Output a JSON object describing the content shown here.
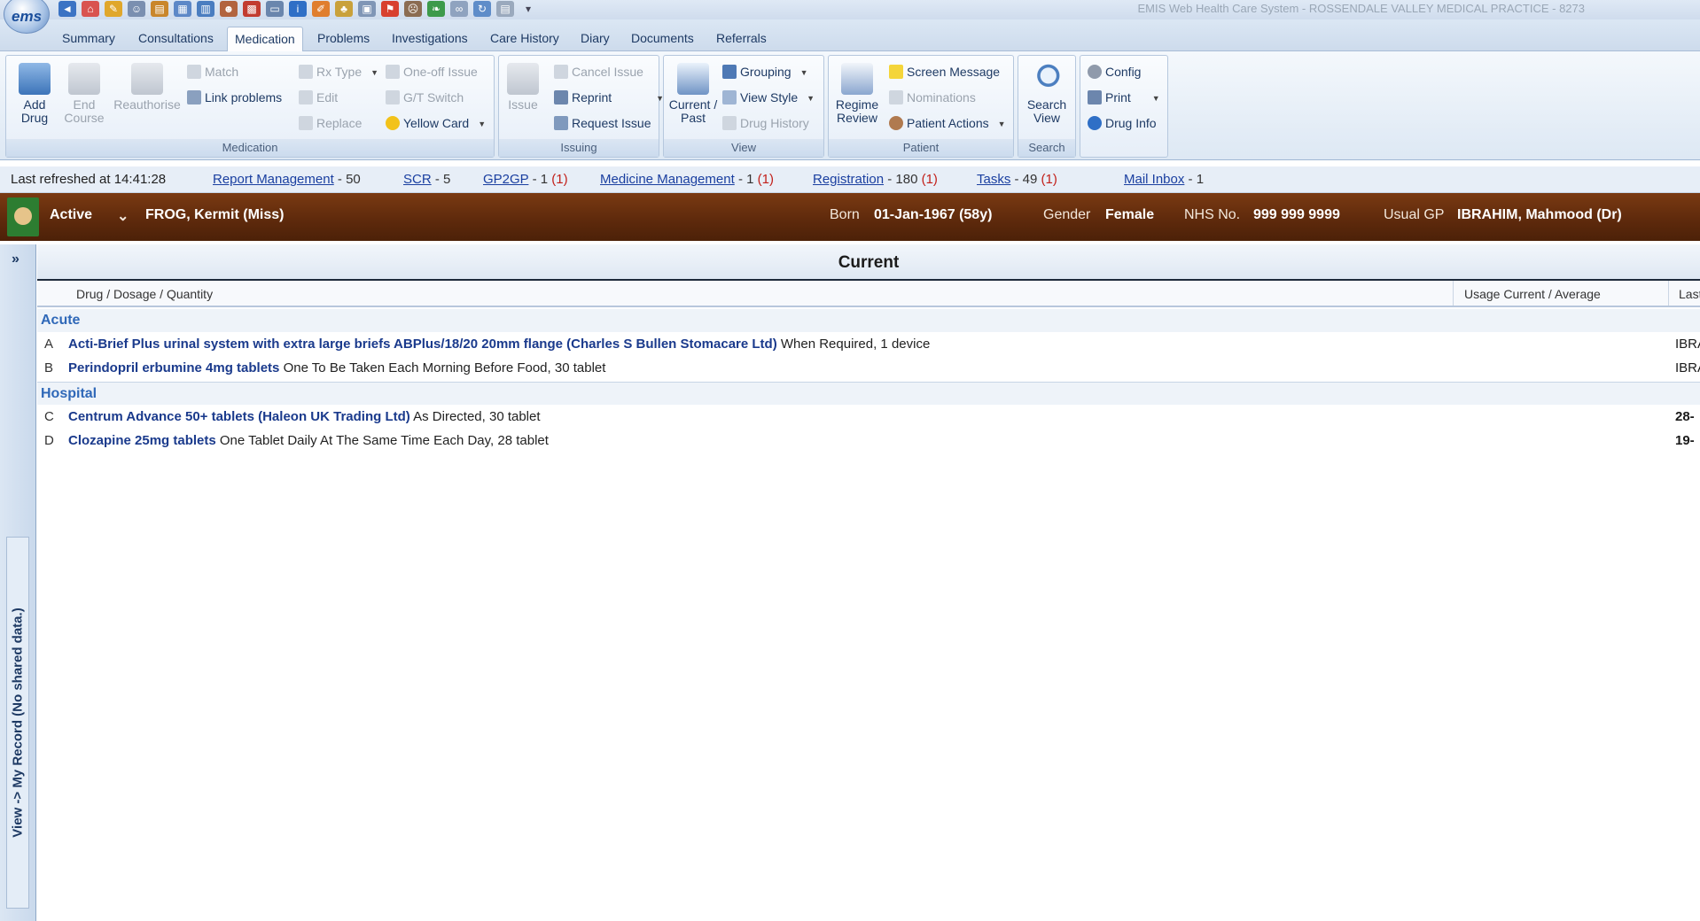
{
  "window": {
    "title": "EMIS Web Health Care System - ROSSENDALE VALLEY MEDICAL PRACTICE - 8273",
    "logo_text": "ems"
  },
  "tabs": [
    {
      "label": "Summary"
    },
    {
      "label": "Consultations"
    },
    {
      "label": "Medication"
    },
    {
      "label": "Problems"
    },
    {
      "label": "Investigations"
    },
    {
      "label": "Care History"
    },
    {
      "label": "Diary"
    },
    {
      "label": "Documents"
    },
    {
      "label": "Referrals"
    }
  ],
  "ribbon": {
    "medication": {
      "group": "Medication",
      "add_drug": "Add Drug",
      "end_course": "End Course",
      "reauthorise": "Reauthorise",
      "match": "Match",
      "link_problems": "Link problems",
      "edit": "Edit",
      "replace": "Replace",
      "rx_type": "Rx Type",
      "gt_switch": "G/T Switch",
      "one_off_issue": "One-off Issue",
      "yellow_card": "Yellow Card"
    },
    "issuing": {
      "group": "Issuing",
      "issue": "Issue",
      "cancel_issue": "Cancel Issue",
      "reprint": "Reprint",
      "request_issue": "Request Issue"
    },
    "view": {
      "group": "View",
      "current_past": "Current / Past",
      "grouping": "Grouping",
      "view_style": "View Style",
      "drug_history": "Drug History"
    },
    "patient": {
      "group": "Patient",
      "regime_review": "Regime Review",
      "screen_message": "Screen Message",
      "nominations": "Nominations",
      "patient_actions": "Patient Actions"
    },
    "search": {
      "group": "Search",
      "search_view": "Search View"
    },
    "misc": {
      "config": "Config",
      "print": "Print",
      "drug_info": "Drug Info"
    }
  },
  "status": {
    "last_refreshed_label": "Last refreshed at",
    "last_refreshed_time": "14:41:28",
    "items": [
      {
        "link": "Report Management",
        "count": "- 50",
        "alert": ""
      },
      {
        "link": "SCR",
        "count": "- 5",
        "alert": ""
      },
      {
        "link": "GP2GP",
        "count": "- 1",
        "alert": "(1)"
      },
      {
        "link": "Medicine Management",
        "count": "- 1",
        "alert": "(1)"
      },
      {
        "link": "Registration",
        "count": "- 180",
        "alert": "(1)"
      },
      {
        "link": "Tasks",
        "count": "- 49",
        "alert": "(1)"
      },
      {
        "link": "Mail Inbox",
        "count": "- 1",
        "alert": ""
      }
    ]
  },
  "patient": {
    "status": "Active",
    "name": "FROG, Kermit (Miss)",
    "born_label": "Born",
    "born": "01-Jan-1967 (58y)",
    "gender_label": "Gender",
    "gender": "Female",
    "nhs_label": "NHS No.",
    "nhs": "999 999 9999",
    "gp_label": "Usual GP",
    "gp": "IBRAHIM, Mahmood (Dr)"
  },
  "side": {
    "vertical_label": "View -> My Record (No shared data.)"
  },
  "grid": {
    "title": "Current",
    "columns": {
      "drug": "Drug / Dosage / Quantity",
      "usage": "Usage Current / Average",
      "last": "Last"
    },
    "groups": [
      {
        "name": "Acute",
        "rows": [
          {
            "letter": "A",
            "drug": "Acti-Brief Plus urinal system with extra large briefs ABPlus/18/20 20mm flange (Charles S Bullen Stomacare Ltd)",
            "dosage": "When Required, 1 device",
            "last": "IBRA"
          },
          {
            "letter": "B",
            "drug": "Perindopril erbumine 4mg tablets",
            "dosage": "One To Be Taken Each Morning Before Food, 30 tablet",
            "last": "IBRA"
          }
        ]
      },
      {
        "name": "Hospital",
        "rows": [
          {
            "letter": "C",
            "drug": "Centrum Advance 50+ tablets (Haleon UK Trading Ltd)",
            "dosage": "As Directed, 30 tablet",
            "last": "28-"
          },
          {
            "letter": "D",
            "drug": "Clozapine 25mg tablets",
            "dosage": "One Tablet Daily At The Same Time Each Day, 28 tablet",
            "last": "19-"
          }
        ]
      }
    ]
  }
}
